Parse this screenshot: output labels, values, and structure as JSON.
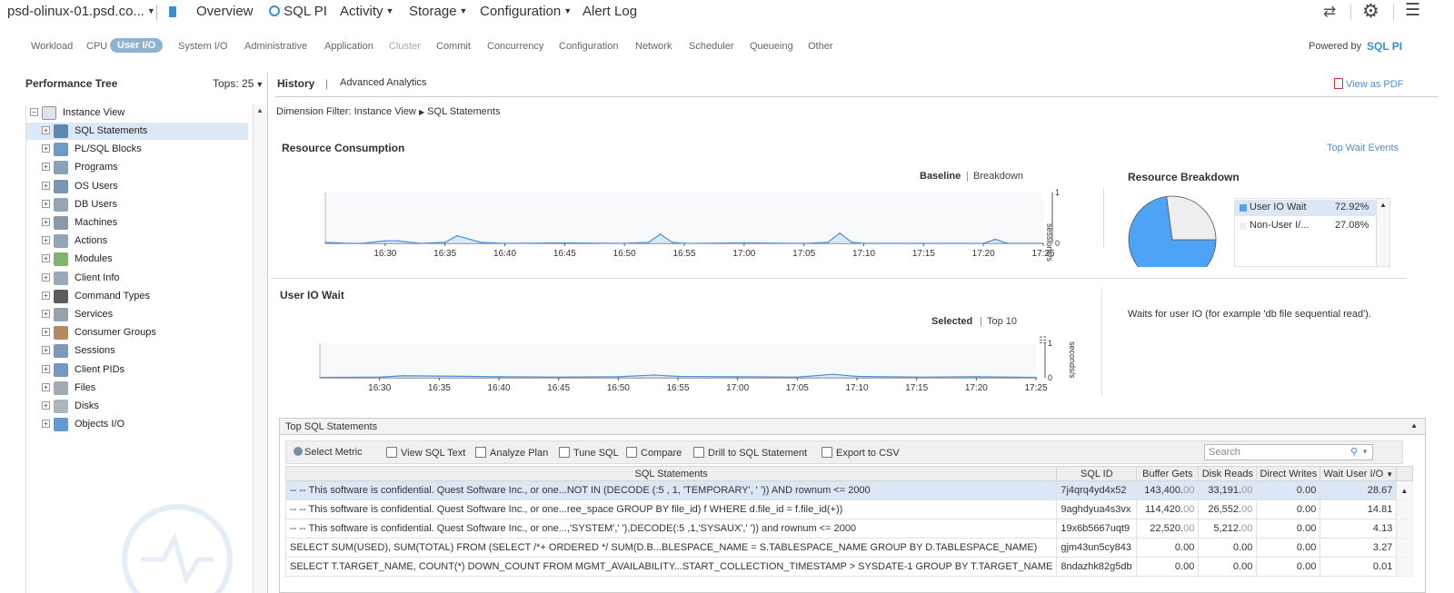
{
  "topbar": {
    "host": "psd-olinux-01.psd.co...",
    "overview": "Overview",
    "sqlpi": "SQL PI",
    "activity": "Activity",
    "storage": "Storage",
    "configuration": "Configuration",
    "alert_log": "Alert Log"
  },
  "subtabs": [
    "Workload",
    "CPU",
    "User I/O",
    "System I/O",
    "Administrative",
    "Application",
    "Cluster",
    "Commit",
    "Concurrency",
    "Configuration",
    "Network",
    "Scheduler",
    "Queueing",
    "Other"
  ],
  "subtabs_active": "User I/O",
  "subtabs_disabled": "Cluster",
  "powered_by": "Powered by",
  "powered_brand": "SQL PI",
  "left": {
    "title": "Performance Tree",
    "tops_label": "Tops:",
    "tops_value": "25",
    "root": "Instance View",
    "items": [
      "SQL Statements",
      "PL/SQL Blocks",
      "Programs",
      "OS Users",
      "DB Users",
      "Machines",
      "Actions",
      "Modules",
      "Client Info",
      "Command Types",
      "Services",
      "Consumer Groups",
      "Sessions",
      "Client PIDs",
      "Files",
      "Disks",
      "Objects I/O"
    ],
    "selected": "SQL Statements"
  },
  "main": {
    "tab_history": "History",
    "tab_analytics": "Advanced Analytics",
    "view_pdf": "View as PDF",
    "dim_filter_label": "Dimension Filter:",
    "dim_filter_root": "Instance View",
    "dim_filter_leaf": "SQL Statements"
  },
  "resource": {
    "title": "Resource Consumption",
    "top_wait": "Top Wait Events",
    "baseline": "Baseline",
    "breakdown": "Breakdown",
    "unit": "sessions/s",
    "breakdown_title": "Resource Breakdown",
    "legend": [
      {
        "name": "User IO Wait",
        "value": "72.92%",
        "color": "#4da3f5"
      },
      {
        "name": "Non-User I/...",
        "value": "27.08%",
        "color": "#eeeeee"
      }
    ]
  },
  "userio": {
    "title": "User IO Wait",
    "selected": "Selected",
    "top10": "Top 10",
    "unit": "seconds/s",
    "description": "Waits for user IO (for example 'db file sequential read')."
  },
  "chart_data": [
    {
      "type": "area",
      "title": "",
      "xlabel": "",
      "ylabel": "sessions/s",
      "ylim": [
        0,
        1
      ],
      "x": [
        "16:25",
        "16:27",
        "16:28",
        "16:30",
        "16:31",
        "16:33",
        "16:35",
        "16:36",
        "16:38",
        "16:40",
        "16:45",
        "16:50",
        "16:52",
        "16:53",
        "16:54",
        "16:55",
        "17:00",
        "17:05",
        "17:07",
        "17:08",
        "17:09",
        "17:10",
        "17:15",
        "17:20",
        "17:21",
        "17:22",
        "17:25"
      ],
      "series": [
        {
          "values": [
            0.02,
            0.0,
            0.0,
            0.05,
            0.05,
            0.0,
            0.02,
            0.15,
            0.02,
            0.0,
            0.01,
            0.0,
            0.02,
            0.18,
            0.02,
            0.0,
            0.01,
            0.0,
            0.02,
            0.2,
            0.02,
            0.0,
            0.0,
            0.0,
            0.08,
            0.0,
            0.0
          ]
        }
      ],
      "xticks": [
        "16:30",
        "16:35",
        "16:40",
        "16:45",
        "16:50",
        "16:55",
        "17:00",
        "17:05",
        "17:10",
        "17:15",
        "17:20",
        "17:25"
      ],
      "yticks": [
        "0",
        "1"
      ]
    },
    {
      "type": "pie",
      "title": "",
      "categories": [
        "User IO Wait",
        "Non-User I/..."
      ],
      "values": [
        72.92,
        27.08
      ]
    },
    {
      "type": "area",
      "title": "",
      "xlabel": "",
      "ylabel": "seconds/s",
      "ylim": [
        0,
        1
      ],
      "x": [
        "16:25",
        "16:30",
        "16:32",
        "16:35",
        "16:40",
        "16:45",
        "16:50",
        "16:53",
        "16:55",
        "17:00",
        "17:05",
        "17:08",
        "17:10",
        "17:15",
        "17:20",
        "17:25"
      ],
      "series": [
        {
          "values": [
            0.01,
            0.02,
            0.06,
            0.05,
            0.03,
            0.02,
            0.03,
            0.08,
            0.04,
            0.03,
            0.02,
            0.1,
            0.04,
            0.02,
            0.03,
            0.01
          ]
        }
      ],
      "xticks": [
        "16:30",
        "16:35",
        "16:40",
        "16:45",
        "16:50",
        "16:55",
        "17:00",
        "17:05",
        "17:10",
        "17:15",
        "17:20",
        "17:25"
      ],
      "yticks": [
        "0",
        "1"
      ]
    }
  ],
  "sql": {
    "title": "Top SQL Statements",
    "toolbar": [
      "Select Metric",
      "View SQL Text",
      "Analyze Plan",
      "Tune SQL",
      "Compare",
      "Drill to SQL Statement",
      "Export to CSV"
    ],
    "search_placeholder": "Search",
    "columns": [
      "SQL Statements",
      "SQL ID",
      "Buffer Gets",
      "Disk Reads",
      "Direct Writes",
      "Wait User I/O"
    ],
    "rows": [
      [
        "-- -- This software is confidential. Quest Software Inc., or one...NOT IN (DECODE (:5 , 1, 'TEMPORARY', ' ')) AND rownum <= 2000",
        "7j4qrq4yd4x52",
        "143,400.",
        "00",
        "33,191.",
        "00",
        "0.00",
        "28.67"
      ],
      [
        "-- -- This software is confidential. Quest Software Inc., or one...ree_space GROUP BY file_id) f WHERE d.file_id = f.file_id(+))",
        "9aghdyua4s3vx",
        "114,420.",
        "00",
        "26,552.",
        "00",
        "0.00",
        "14.81"
      ],
      [
        "-- -- This software is confidential. Quest Software Inc., or one...,'SYSTEM',' '),DECODE(:5 ,1,'SYSAUX',' ')) and rownum <= 2000",
        "19x6b5667uqt9",
        "22,520.",
        "00",
        "5,212.",
        "00",
        "0.00",
        "4.13"
      ],
      [
        "SELECT SUM(USED), SUM(TOTAL) FROM (SELECT /*+ ORDERED */ SUM(D.B...BLESPACE_NAME = S.TABLESPACE_NAME GROUP BY D.TABLESPACE_NAME)",
        "gjm43un5cy843",
        "0.00",
        "",
        "0.00",
        "",
        "0.00",
        "3.27"
      ],
      [
        "SELECT T.TARGET_NAME, COUNT(*) DOWN_COUNT FROM MGMT_AVAILABILITY...START_COLLECTION_TIMESTAMP > SYSDATE-1 GROUP BY T.TARGET_NAME",
        "8ndazhk82g5db",
        "0.00",
        "",
        "0.00",
        "",
        "0.00",
        "0.01"
      ]
    ]
  }
}
